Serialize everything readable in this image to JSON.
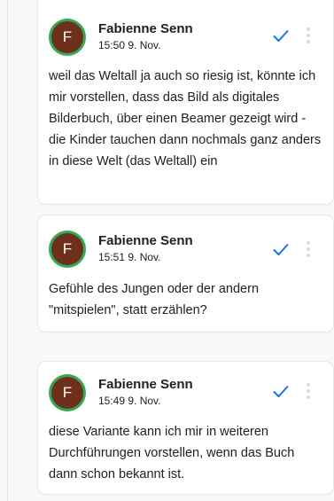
{
  "comments": [
    {
      "avatar_letter": "F",
      "author": "Fabienne Senn",
      "time": "15:50 9. Nov.",
      "text": "weil das Weltall ja auch so riesig ist, könnte ich mir vorstellen, dass das Bild als digitales Bilderbuch, über einen Beamer gezeigt wird - die Kinder tauchen dann nochmals ganz anders in diese Welt (das Weltall) ein",
      "resolve_icon": "check-icon",
      "menu_icon": "more-vert-icon"
    },
    {
      "avatar_letter": "F",
      "author": "Fabienne Senn",
      "time": "15:51 9. Nov.",
      "text": "Gefühle des Jungen oder der andern \"mitspielen\", statt erzählen?",
      "resolve_icon": "check-icon",
      "menu_icon": "more-vert-icon"
    },
    {
      "avatar_letter": "F",
      "author": "Fabienne Senn",
      "time": "15:49 9. Nov.",
      "text": "diese Variante kann ich mir in weiteren Durchführungen vorstellen, wenn das Buch dann schon bekannt ist.",
      "resolve_icon": "check-icon",
      "menu_icon": "more-vert-icon"
    }
  ],
  "colors": {
    "avatar_bg": "#6e2f1c",
    "avatar_ring": "#34a853",
    "check": "#1a73e8",
    "menu_dots": "#dadce0"
  }
}
